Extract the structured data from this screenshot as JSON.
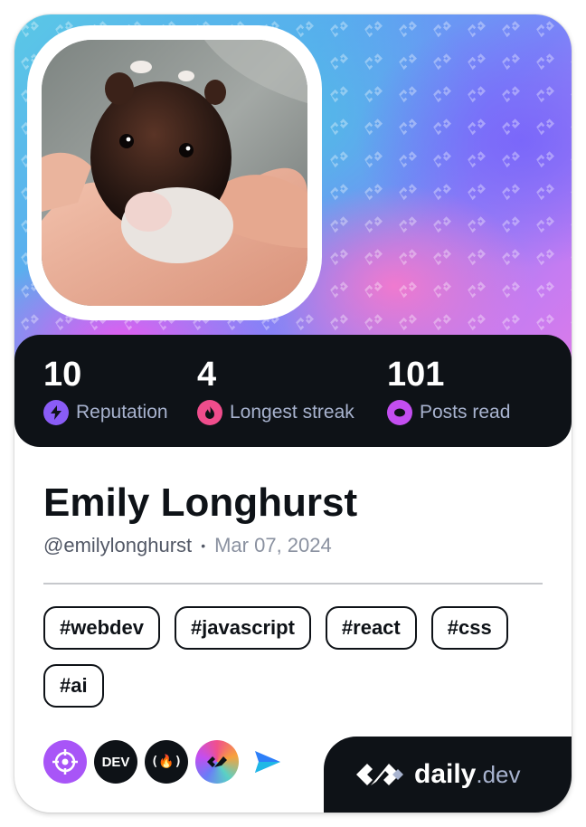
{
  "profile": {
    "name": "Emily Longhurst",
    "handle": "@emilylonghurst",
    "separator": "•",
    "joined": "Mar 07, 2024"
  },
  "stats": [
    {
      "value": "10",
      "label": "Reputation",
      "icon": "lightning-icon",
      "color": "#8a5cf6"
    },
    {
      "value": "4",
      "label": "Longest streak",
      "icon": "flame-icon",
      "color": "#ef4d8c"
    },
    {
      "value": "101",
      "label": "Posts read",
      "icon": "eye-ring-icon",
      "color": "#c34ef0"
    }
  ],
  "tags": [
    "#webdev",
    "#javascript",
    "#react",
    "#css",
    "#ai"
  ],
  "sources": [
    {
      "icon": "crosshair-icon",
      "color": "#a855f7"
    },
    {
      "icon": "dev-logo-icon",
      "label": "DEV",
      "color": "#0e1217"
    },
    {
      "icon": "freecodecamp-icon",
      "label": "(🔥)",
      "color": "#0e1217"
    },
    {
      "icon": "dailydev-gradient-icon",
      "color": "#f0508c"
    },
    {
      "icon": "paper-plane-icon",
      "color": "#2d7ff9"
    }
  ],
  "brand": {
    "name": "daily",
    "tld": ".dev"
  },
  "colors": {
    "dark": "#0e1217",
    "muted": "#a8b3cf",
    "card": "#ffffff"
  }
}
